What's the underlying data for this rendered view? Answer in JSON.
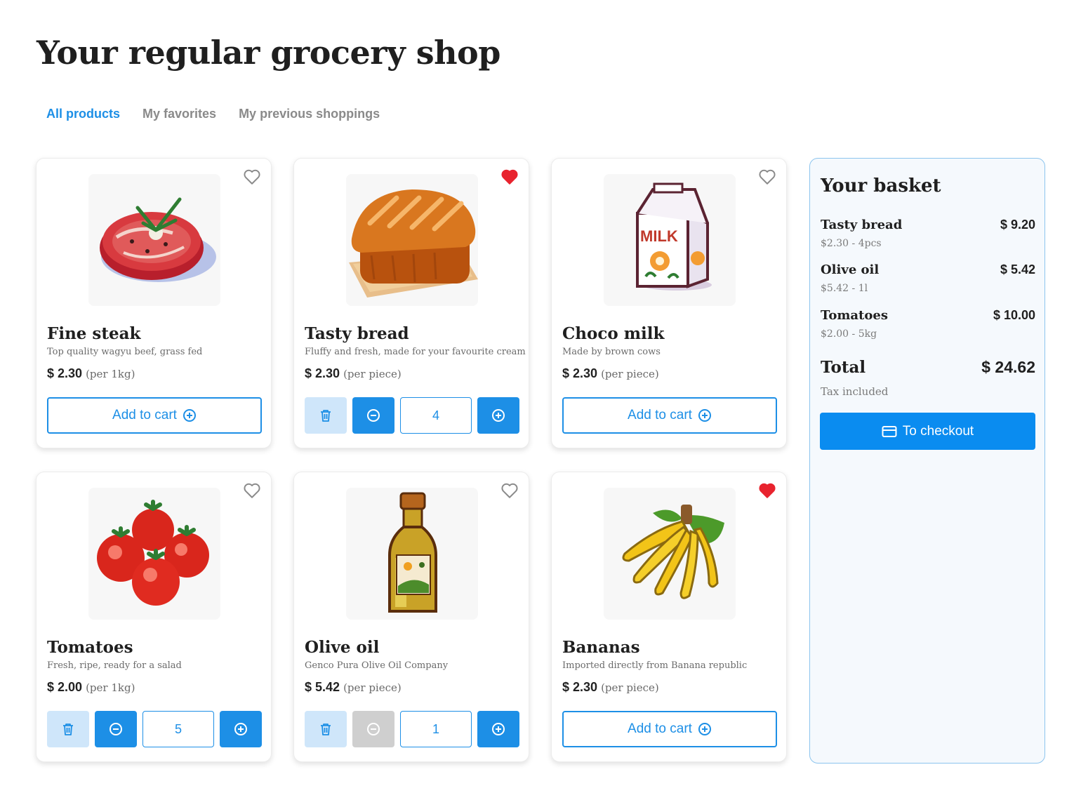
{
  "page_title": "Your regular grocery shop",
  "tabs": [
    {
      "label": "All products",
      "active": true
    },
    {
      "label": "My favorites",
      "active": false
    },
    {
      "label": "My previous shoppings",
      "active": false
    }
  ],
  "products": [
    {
      "name": "Fine steak",
      "description": "Top quality wagyu beef, grass fed",
      "price": "$ 2.30",
      "unit": "(per 1kg)",
      "favorite": false,
      "image_icon": "steak-image",
      "add_label": "Add to cart"
    },
    {
      "name": "Tasty bread",
      "description": "Fluffy and fresh, made for your favourite cream",
      "price": "$ 2.30",
      "unit": "(per piece)",
      "favorite": true,
      "image_icon": "bread-image",
      "quantity": "4"
    },
    {
      "name": "Choco milk",
      "description": "Made by brown cows",
      "price": "$ 2.30",
      "unit": "(per piece)",
      "favorite": false,
      "image_icon": "milk-carton-image",
      "add_label": "Add to cart"
    },
    {
      "name": "Tomatoes",
      "description": "Fresh, ripe, ready for a salad",
      "price": "$ 2.00",
      "unit": "(per 1kg)",
      "favorite": false,
      "image_icon": "tomatoes-image",
      "quantity": "5"
    },
    {
      "name": "Olive oil",
      "description": "Genco Pura Olive Oil Company",
      "price": "$ 5.42",
      "unit": "(per piece)",
      "favorite": false,
      "image_icon": "olive-oil-bottle-image",
      "quantity": "1",
      "minus_disabled": true
    },
    {
      "name": "Bananas",
      "description": "Imported directly from Banana republic",
      "price": "$ 2.30",
      "unit": "(per piece)",
      "favorite": true,
      "image_icon": "bananas-image",
      "add_label": "Add to cart"
    }
  ],
  "basket": {
    "title": "Your basket",
    "items": [
      {
        "name": "Tasty bread",
        "detail": "$2.30 - 4pcs",
        "total": "$ 9.20"
      },
      {
        "name": "Olive oil",
        "detail": "$5.42 - 1l",
        "total": "$ 5.42"
      },
      {
        "name": "Tomatoes",
        "detail": "$2.00 - 5kg",
        "total": "$ 10.00"
      }
    ],
    "total_label": "Total",
    "total_value": "$ 24.62",
    "tax_note": "Tax included",
    "checkout_label": "To checkout"
  },
  "colors": {
    "accent": "#1d8fe6",
    "favorite": "#e8232e",
    "trash_bg": "#cfe6fa",
    "disabled": "#cfcfcf"
  }
}
